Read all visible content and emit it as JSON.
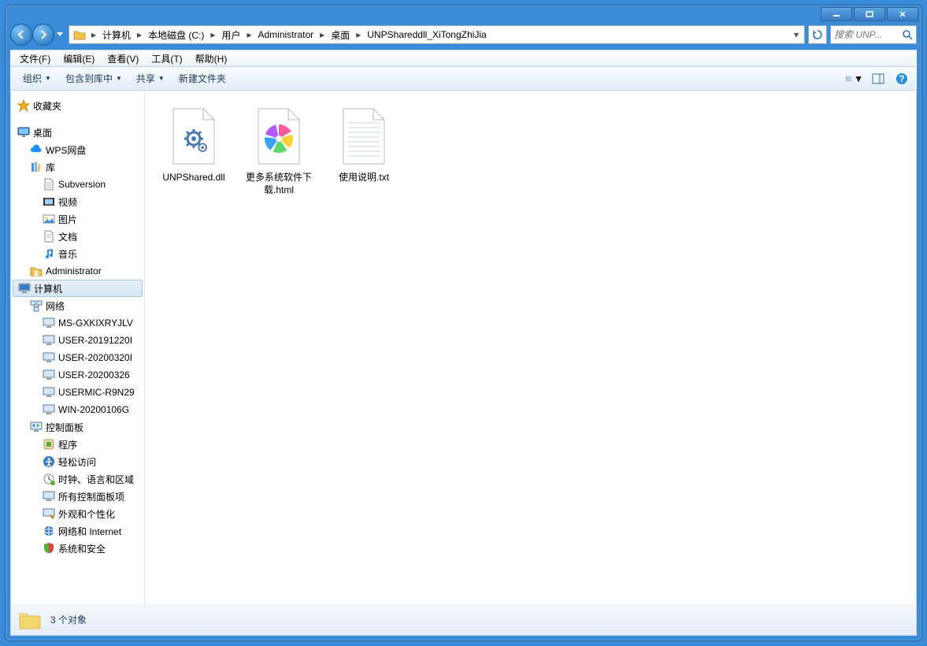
{
  "titlebar": {
    "min": "minimize",
    "max": "maximize",
    "close": "close"
  },
  "breadcrumb": {
    "segments": [
      "计算机",
      "本地磁盘 (C:)",
      "用户",
      "Administrator",
      "桌面",
      "UNPShareddll_XiTongZhiJia"
    ]
  },
  "search": {
    "placeholder": "搜索 UNP..."
  },
  "menubar": {
    "file": "文件(F)",
    "edit": "编辑(E)",
    "view": "查看(V)",
    "tools": "工具(T)",
    "help": "帮助(H)"
  },
  "toolbar": {
    "organize": "组织",
    "include": "包含到库中",
    "share": "共享",
    "newfolder": "新建文件夹"
  },
  "sidebar": {
    "favorites": "收藏夹",
    "desktop": "桌面",
    "wps": "WPS网盘",
    "libraries": "库",
    "lib_subversion": "Subversion",
    "lib_video": "视频",
    "lib_pictures": "图片",
    "lib_documents": "文档",
    "lib_music": "音乐",
    "administrator": "Administrator",
    "computer": "计算机",
    "network": "网络",
    "net_1": "MS-GXKIXRYJLV",
    "net_2": "USER-20191220I",
    "net_3": "USER-20200320I",
    "net_4": "USER-20200326",
    "net_5": "USERMIC-R9N29",
    "net_6": "WIN-20200106G",
    "controlpanel": "控制面板",
    "cp_programs": "程序",
    "cp_ease": "轻松访问",
    "cp_clock": "时钟、语言和区域",
    "cp_all": "所有控制面板项",
    "cp_appearance": "外观和个性化",
    "cp_network": "网络和 Internet",
    "cp_security": "系统和安全"
  },
  "files": {
    "f1": "UNPShared.dll",
    "f2": "更多系统软件下载.html",
    "f3": "使用说明.txt"
  },
  "statusbar": {
    "count": "3 个对象"
  }
}
